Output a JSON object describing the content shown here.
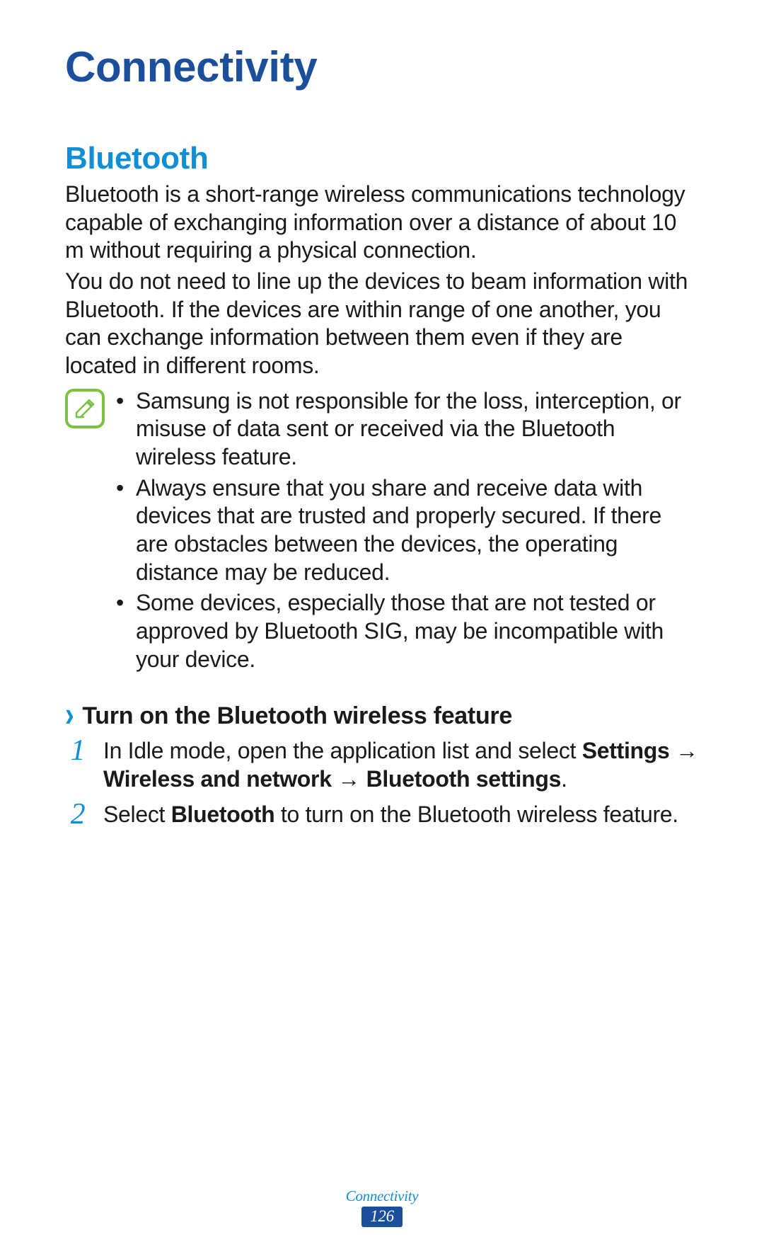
{
  "headings": {
    "h1": "Connectivity",
    "h2": "Bluetooth"
  },
  "paragraphs": {
    "p1": "Bluetooth is a short-range wireless communications technology capable of exchanging information over a distance of about 10 m without requiring a physical connection.",
    "p2": "You do not need to line up the devices to beam information with Bluetooth. If the devices are within range of one another, you can exchange information between them even if they are located in different rooms."
  },
  "notes": [
    "Samsung is not responsible for the loss, interception, or misuse of data sent or received via the Bluetooth wireless feature.",
    "Always ensure that you share and receive data with devices that are trusted and properly secured. If there are obstacles between the devices, the operating distance may be reduced.",
    "Some devices, especially those that are not tested or approved by Bluetooth SIG, may be incompatible with your device."
  ],
  "subsection": {
    "title": "Turn on the Bluetooth wireless feature",
    "steps": {
      "s1_num": "1",
      "s1_a": "In Idle mode, open the application list and select ",
      "s1_b": "Settings",
      "s1_c": " → ",
      "s1_d": "Wireless and network",
      "s1_e": " → ",
      "s1_f": "Bluetooth settings",
      "s1_g": ".",
      "s2_num": "2",
      "s2_a": "Select ",
      "s2_b": "Bluetooth",
      "s2_c": " to turn on the Bluetooth wireless feature."
    }
  },
  "footer": {
    "section": "Connectivity",
    "page": "126"
  }
}
